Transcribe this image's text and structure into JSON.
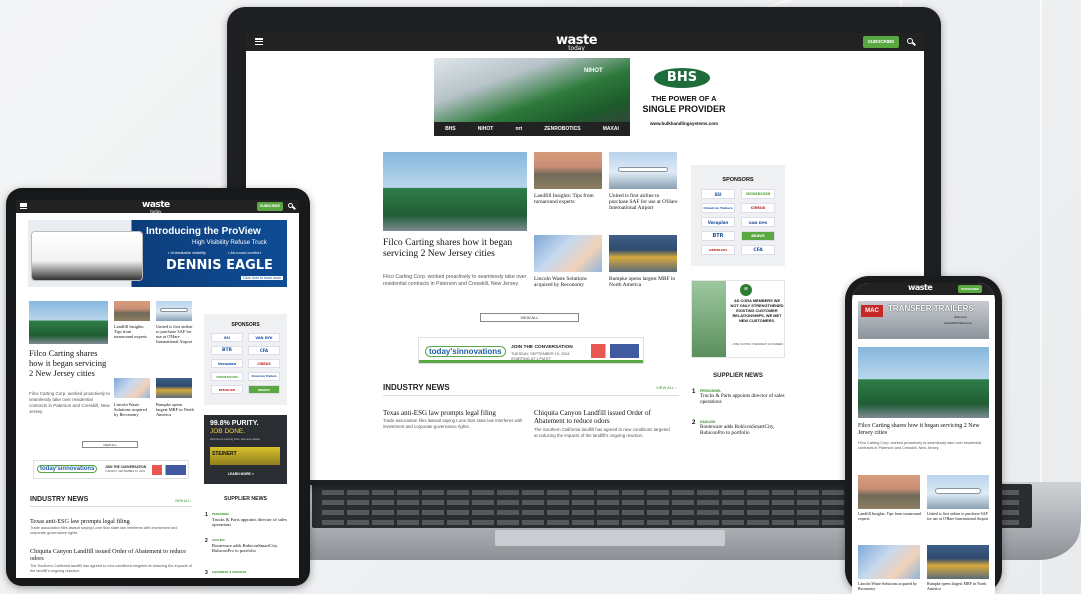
{
  "brand": {
    "logo": "waste",
    "logo_sub": "today",
    "accent": "#5aa842",
    "header_bg": "#222222"
  },
  "header": {
    "subscribe_label": "SUBSCRIBE",
    "menu_icon": "hamburger-icon",
    "search_icon": "search-icon"
  },
  "top_ad": {
    "logo": "BHS",
    "tagline_line1": "THE POWER OF A",
    "tagline_line2": "SINGLE PROVIDER",
    "url": "www.bulkhandlingsystems.com",
    "brands": [
      "BHS",
      "NIHOT",
      "nrt",
      "ZENROBOTICS",
      "MAXAI"
    ],
    "machine_label": "NIHOT"
  },
  "featured": {
    "headline": "Filco Carting shares how it began servicing 2 New Jersey cities",
    "dek": "Filco Carting Corp. worked proactively to seamlessly take over residential contracts in Paterson and Cresskill, New Jersey."
  },
  "stories": [
    {
      "headline": "Landfill Insights: Tips from turnaround experts"
    },
    {
      "headline": "United is first airline to purchase SAF for use at O'Hare International Airport"
    },
    {
      "headline": "Lincoln Waste Solutions acquired by Reconomy"
    },
    {
      "headline": "Rumpke opens largest MRF in North America"
    }
  ],
  "view_all_label": "VIEW ALL",
  "sponsors": {
    "title": "SPONSORS",
    "logos": [
      "SSI",
      "SENNEBOGEN",
      "Cimarron Trailers",
      "CIRRUS",
      "Vecoplan",
      "VAN DYK",
      "BTR",
      "BRAVO",
      "DEMOLISH",
      "CFA"
    ]
  },
  "banner_ad": {
    "brand": "today'sinnovations",
    "line1": "JOIN THE CONVERSATION",
    "line2": "TUESDAY, SEPTEMBER 10, 2024",
    "line3": "STARTING AT 1 PM ET"
  },
  "side_ad": {
    "quote": "AS CORA MEMBERS WE NOT ONLY STRENGTHENED EXISTING CUSTOMER RELATIONSHIPS, WE MET NEW CUSTOMERS.",
    "attribution": "- JOSE CASTRO, PRESIDENT, ECOGREEN"
  },
  "industry_news": {
    "title": "INDUSTRY NEWS",
    "view_all": "VIEW ALL ›",
    "items": [
      {
        "headline": "Texas anti-ESG law prompts legal filing",
        "dek": "Trade association files lawsuit saying Lone Star state law interferes with investment and corporate governance rights."
      },
      {
        "headline": "Chiquita Canyon Landfill issued Order of Abatement to reduce odors",
        "dek": "The Southern California landfill has agreed to new conditions targeted at reducing the impacts of the landfill's ongoing reaction."
      }
    ]
  },
  "supplier_news": {
    "title": "SUPPLIER NEWS",
    "items": [
      {
        "num": "1",
        "tag": "PERSONNEL",
        "headline": "Trucks & Parts appoints director of sales operations"
      },
      {
        "num": "2",
        "tag": "HAULING",
        "headline": "Routeware adds RubiconSmartCity, RubiconPro to portfolio"
      },
      {
        "num": "3",
        "tag": "EQUIPMENT & SERVICES",
        "headline": ""
      }
    ]
  },
  "tablet_ad": {
    "line1": "Introducing the",
    "line1b": "ProView",
    "line2": "High Visibility Refuse Truck",
    "bullet1": "• Unbeatable visibility",
    "bullet2": "• All-round comfort",
    "brand": "DENNIS EAGLE",
    "cta": "Click here to learn more"
  },
  "tablet_side_ad": {
    "line1": "99.8% PURITY.",
    "line2": "JOB DONE.",
    "line3": "Aluminum sorting from wet and waste",
    "brand": "STEINERT",
    "cta": "LEARN MORE >"
  },
  "phone_ad": {
    "brand": "MAC",
    "title": "TRANSFER TRAILERS",
    "cta": "click here",
    "url": "www.MACTrailers.com"
  }
}
